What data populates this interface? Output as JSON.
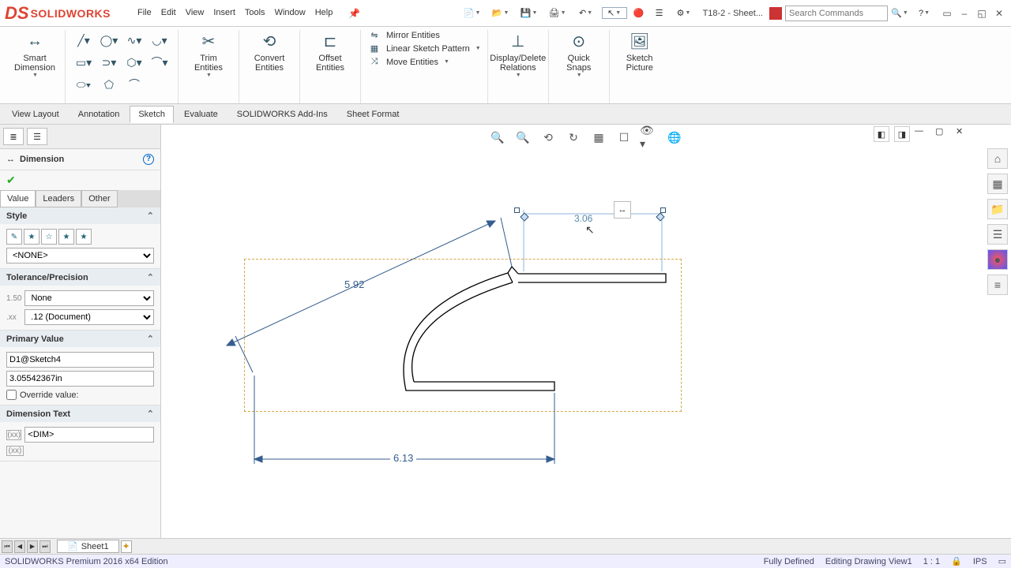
{
  "app": {
    "logo": "SOLIDWORKS"
  },
  "menus": [
    "File",
    "Edit",
    "View",
    "Insert",
    "Tools",
    "Window",
    "Help"
  ],
  "doc_title": "T18-2 - Sheet...",
  "search_placeholder": "Search Commands",
  "ribbon": {
    "smart_dim": "Smart\nDimension",
    "trim": "Trim\nEntities",
    "convert": "Convert\nEntities",
    "offset": "Offset\nEntities",
    "mirror": "Mirror Entities",
    "pattern": "Linear Sketch Pattern",
    "move": "Move Entities",
    "display_delete": "Display/Delete\nRelations",
    "quick_snaps": "Quick\nSnaps",
    "sketch_pic": "Sketch\nPicture"
  },
  "tabs": [
    "View Layout",
    "Annotation",
    "Sketch",
    "Evaluate",
    "SOLIDWORKS Add-Ins",
    "Sheet Format"
  ],
  "active_tab": "Sketch",
  "pm": {
    "title": "Dimension",
    "tabs": [
      "Value",
      "Leaders",
      "Other"
    ],
    "style_label": "Style",
    "style_select": "<NONE>",
    "tol_label": "Tolerance/Precision",
    "tol_select": "None",
    "prec_select": ".12 (Document)",
    "pv_label": "Primary Value",
    "pv_name": "D1@Sketch4",
    "pv_value": "3.05542367in",
    "override": "Override value:",
    "dimtext_label": "Dimension Text",
    "dimtext_val": "<DIM>"
  },
  "canvas": {
    "dim1": "5.92",
    "dim2": "6.13",
    "dim_edit": "3.06"
  },
  "sheet": "Sheet1",
  "status": {
    "left": "SOLIDWORKS Premium 2016 x64 Edition",
    "defined": "Fully Defined",
    "editing": "Editing Drawing View1",
    "scale": "1 : 1",
    "units": "IPS"
  }
}
